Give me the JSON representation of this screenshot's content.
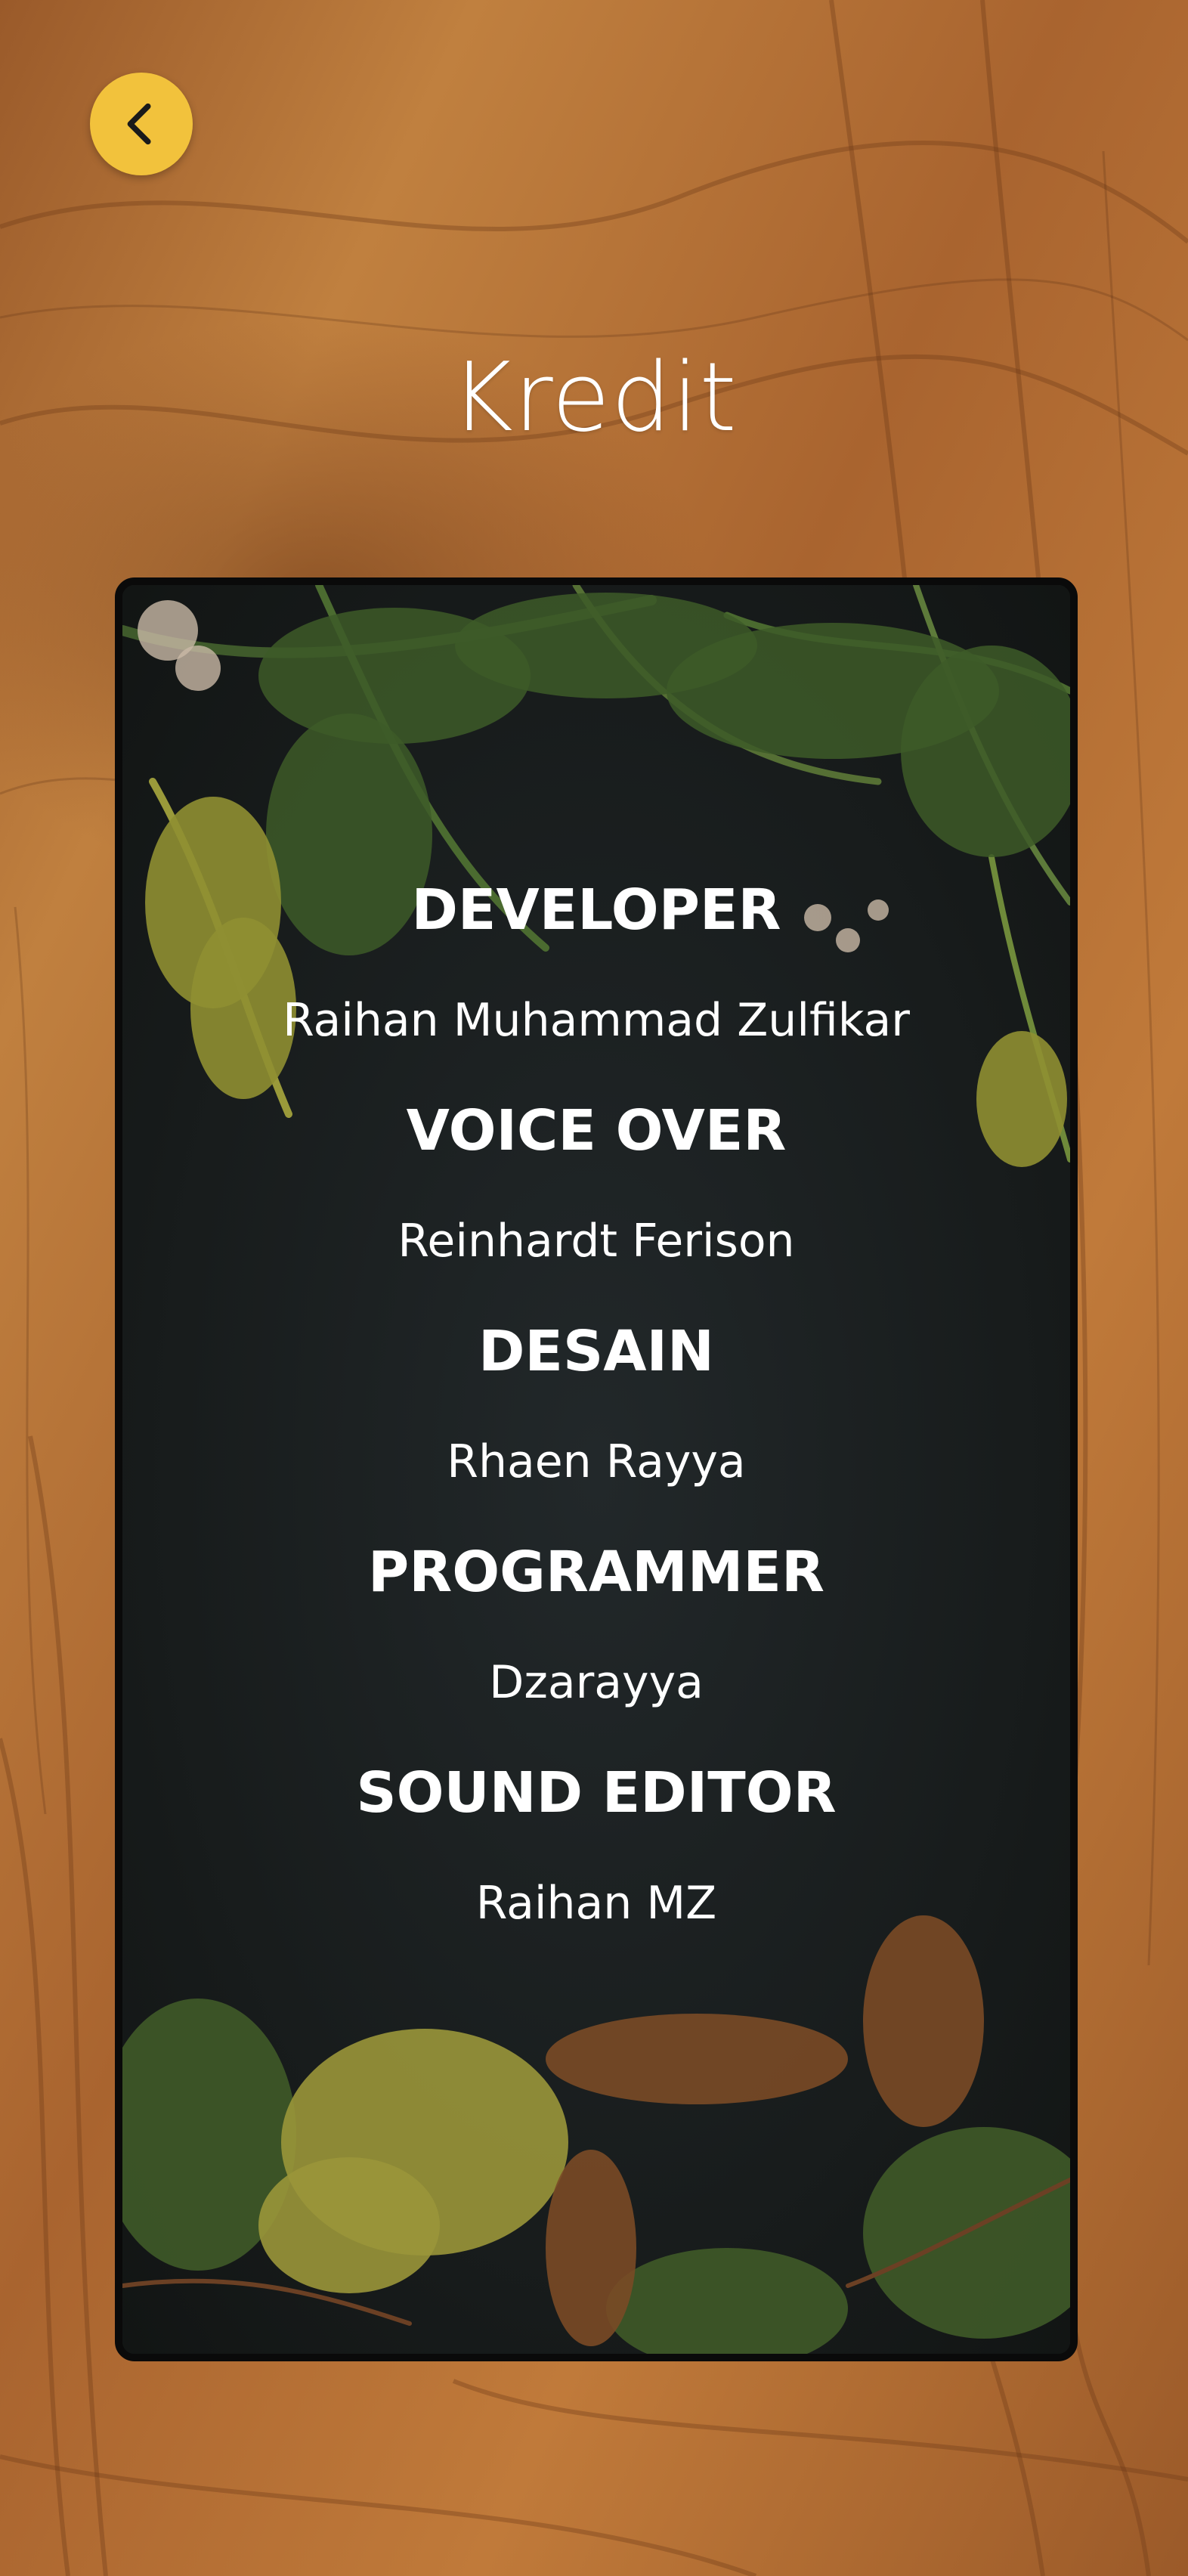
{
  "header": {
    "back_icon": "chevron-left-icon",
    "title": "Kredit"
  },
  "credits": [
    {
      "role": "DEVELOPER",
      "name": "Raihan Muhammad Zulfikar"
    },
    {
      "role": "VOICE OVER",
      "name": "Reinhardt Ferison"
    },
    {
      "role": "DESAIN",
      "name": "Rhaen Rayya"
    },
    {
      "role": "PROGRAMMER",
      "name": "Dzarayya"
    },
    {
      "role": "SOUND EDITOR",
      "name": "Raihan MZ"
    }
  ],
  "colors": {
    "accent": "#f2c23c",
    "wood": "#b06f35",
    "card_background": "#1a1e1c",
    "text": "#ffffff"
  }
}
